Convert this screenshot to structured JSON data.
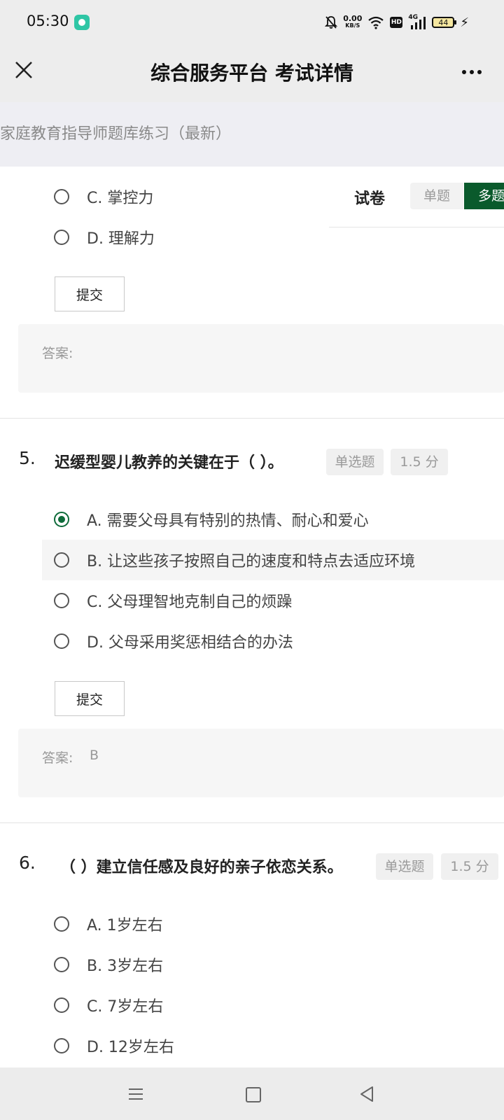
{
  "status_bar": {
    "time": "05:30",
    "net_speed": "0.00",
    "net_speed_unit": "KB/S",
    "hd_label": "HD",
    "signal_label": "4G",
    "battery": "44"
  },
  "header": {
    "title": "综合服务平台 考试详情"
  },
  "subtitle": "家庭教育指导师题库练习（最新）",
  "paper_panel": {
    "label": "试卷",
    "tab_single": "单题",
    "tab_multi": "多题"
  },
  "question4": {
    "options": [
      {
        "label": "C. 掌控力"
      },
      {
        "label": "D. 理解力"
      }
    ],
    "submit_label": "提交",
    "answer_label": "答案:",
    "answer_value": ""
  },
  "question5": {
    "number": "5.",
    "text": "迟缓型婴儿教养的关键在于（ ）。",
    "type_tag": "单选题",
    "score_tag": "1.5 分",
    "options": [
      {
        "label": "A. 需要父母具有特别的热情、耐心和爱心"
      },
      {
        "label": "B. 让这些孩子按照自己的速度和特点去适应环境"
      },
      {
        "label": "C. 父母理智地克制自己的烦躁"
      },
      {
        "label": "D. 父母采用奖惩相结合的办法"
      }
    ],
    "selected": "A",
    "submit_label": "提交",
    "answer_label": "答案:",
    "answer_value": "B"
  },
  "question6": {
    "number": "6.",
    "text": "（ ）建立信任感及良好的亲子依恋关系。",
    "type_tag": "单选题",
    "score_tag": "1.5 分",
    "options": [
      {
        "label": "A. 1岁左右"
      },
      {
        "label": "B. 3岁左右"
      },
      {
        "label": "C. 7岁左右"
      },
      {
        "label": "D. 12岁左右"
      }
    ]
  },
  "colors": {
    "accent": "#0a5a2c",
    "header_bg": "#ededed",
    "subtitle_bg": "#eeeef3"
  }
}
